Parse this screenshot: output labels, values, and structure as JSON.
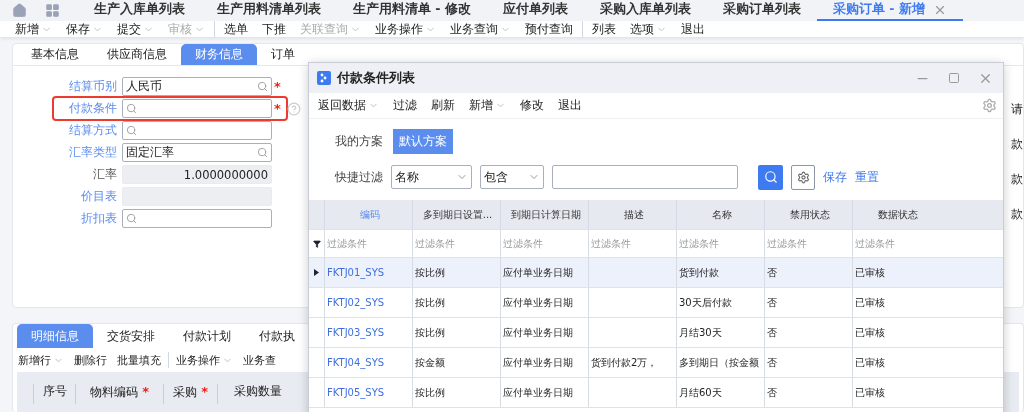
{
  "app_tabs": [
    {
      "label": "生产入库单列表",
      "selected": false,
      "closable": false
    },
    {
      "label": "生产用料清单列表",
      "selected": false,
      "closable": false
    },
    {
      "label": "生产用料清单 - 修改",
      "selected": false,
      "closable": false
    },
    {
      "label": "应付单列表",
      "selected": false,
      "closable": false
    },
    {
      "label": "采购入库单列表",
      "selected": false,
      "closable": false
    },
    {
      "label": "采购订单列表",
      "selected": false,
      "closable": false
    },
    {
      "label": "采购订单 - 新增",
      "selected": true,
      "closable": true
    }
  ],
  "toolbar": [
    {
      "kind": "button",
      "label": "新增",
      "dropdown": true,
      "disabled": false
    },
    {
      "kind": "button",
      "label": "保存",
      "dropdown": true,
      "disabled": false
    },
    {
      "kind": "button",
      "label": "提交",
      "dropdown": true,
      "disabled": false
    },
    {
      "kind": "button",
      "label": "审核",
      "dropdown": true,
      "disabled": true
    },
    {
      "kind": "separator"
    },
    {
      "kind": "button",
      "label": "选单",
      "dropdown": false,
      "disabled": false
    },
    {
      "kind": "button",
      "label": "下推",
      "dropdown": false,
      "disabled": false
    },
    {
      "kind": "button",
      "label": "关联查询",
      "dropdown": true,
      "disabled": true
    },
    {
      "kind": "button",
      "label": "业务操作",
      "dropdown": true,
      "disabled": false
    },
    {
      "kind": "button",
      "label": "业务查询",
      "dropdown": true,
      "disabled": false
    },
    {
      "kind": "button",
      "label": "预付查询",
      "dropdown": false,
      "disabled": false
    },
    {
      "kind": "separator"
    },
    {
      "kind": "button",
      "label": "列表",
      "dropdown": false,
      "disabled": false
    },
    {
      "kind": "button",
      "label": "选项",
      "dropdown": true,
      "disabled": false
    },
    {
      "kind": "button",
      "label": "退出",
      "dropdown": false,
      "disabled": false
    }
  ],
  "form": {
    "tabs": [
      {
        "label": "基本信息",
        "selected": false
      },
      {
        "label": "供应商信息",
        "selected": false
      },
      {
        "label": "财务信息",
        "selected": true
      },
      {
        "label": "订单",
        "selected": false
      }
    ],
    "fields": [
      {
        "label": "结算币别",
        "value": "人民币",
        "link": true,
        "lookup": true,
        "readonly": false,
        "required_mark": "*",
        "highlighted": false,
        "help": false
      },
      {
        "label": "付款条件",
        "link": true,
        "lookup": true,
        "readonly": false,
        "required_mark": "*",
        "highlighted": true,
        "help": true
      },
      {
        "label": "结算方式",
        "link": true,
        "lookup": true,
        "readonly": false,
        "highlighted": false,
        "help": false
      },
      {
        "label": "汇率类型",
        "value": "固定汇率",
        "link": true,
        "lookup": true,
        "readonly": false,
        "highlighted": false,
        "help": false
      },
      {
        "label": "汇率",
        "value": "1.0000000000",
        "link": false,
        "lookup": false,
        "readonly": true,
        "highlighted": false,
        "help": false
      },
      {
        "label": "价目表",
        "link": true,
        "lookup": false,
        "readonly": true,
        "highlighted": false,
        "help": false
      },
      {
        "label": "折扣表",
        "link": true,
        "lookup": true,
        "readonly": false,
        "highlighted": false,
        "help": false
      }
    ],
    "side_labels": [
      "请",
      "款",
      "款",
      "款"
    ]
  },
  "detail": {
    "tabs": [
      {
        "label": "明细信息",
        "selected": true
      },
      {
        "label": "交货安排",
        "selected": false
      },
      {
        "label": "付款计划",
        "selected": false
      },
      {
        "label": "付款执",
        "selected": false
      }
    ],
    "toolbar": [
      {
        "kind": "button",
        "label": "新增行",
        "dropdown": true
      },
      {
        "kind": "button",
        "label": "删除行",
        "dropdown": false
      },
      {
        "kind": "button",
        "label": "批量填充",
        "dropdown": false
      },
      {
        "kind": "separator"
      },
      {
        "kind": "button",
        "label": "业务操作",
        "dropdown": true
      },
      {
        "kind": "button",
        "label": "业务查",
        "dropdown": false
      }
    ],
    "columns": [
      {
        "label": "序号"
      },
      {
        "label": "物料编码",
        "required_mark": "*"
      },
      {
        "label": "采购",
        "required_mark": "*"
      },
      {
        "label": "采购数量"
      }
    ]
  },
  "dialog": {
    "title": "付款条件列表",
    "toolbar": [
      {
        "label": "返回数据",
        "dropdown": true
      },
      {
        "label": "过滤",
        "dropdown": false
      },
      {
        "label": "刷新",
        "dropdown": false
      },
      {
        "label": "新增",
        "dropdown": true
      },
      {
        "label": "修改",
        "dropdown": false
      },
      {
        "label": "退出",
        "dropdown": false
      }
    ],
    "scheme_label": "我的方案",
    "schemes": [
      {
        "label": "默认方案",
        "selected": true
      }
    ],
    "filter_label": "快捷过滤",
    "filter_field": "名称",
    "filter_operator": "包含",
    "actions": [
      "保存",
      "重置"
    ],
    "columns": [
      {
        "label": "编码",
        "active": true,
        "filter_placeholder": "过滤条件"
      },
      {
        "label": "多到期日设置...",
        "active": false,
        "filter_placeholder": "过滤条件"
      },
      {
        "label": "到期日计算日期",
        "active": false,
        "filter_placeholder": "过滤条件"
      },
      {
        "label": "描述",
        "active": false,
        "filter_placeholder": "过滤条件"
      },
      {
        "label": "名称",
        "active": false,
        "filter_placeholder": "过滤条件"
      },
      {
        "label": "禁用状态",
        "active": false,
        "filter_placeholder": "过滤条件"
      },
      {
        "label": "数据状态",
        "active": false,
        "filter_placeholder": "过滤条件"
      }
    ],
    "rows": [
      {
        "selected": true,
        "cells": [
          "FKTJ01_SYS",
          "按比例",
          "应付单业务日期",
          "",
          "货到付款",
          "否",
          "已审核"
        ]
      },
      {
        "selected": false,
        "cells": [
          "FKTJ02_SYS",
          "按比例",
          "应付单业务日期",
          "",
          "30天后付款",
          "否",
          "已审核"
        ]
      },
      {
        "selected": false,
        "cells": [
          "FKTJ03_SYS",
          "按比例",
          "应付单业务日期",
          "",
          "月结30天",
          "否",
          "已审核"
        ]
      },
      {
        "selected": false,
        "cells": [
          "FKTJ04_SYS",
          "按金额",
          "应付单业务日期",
          "货到付款2万，",
          "多到期日（按金额",
          "否",
          "已审核"
        ]
      },
      {
        "selected": false,
        "cells": [
          "FKTJ05_SYS",
          "按比例",
          "应付单业务日期",
          "",
          "月结60天",
          "否",
          "已审核"
        ]
      }
    ]
  }
}
